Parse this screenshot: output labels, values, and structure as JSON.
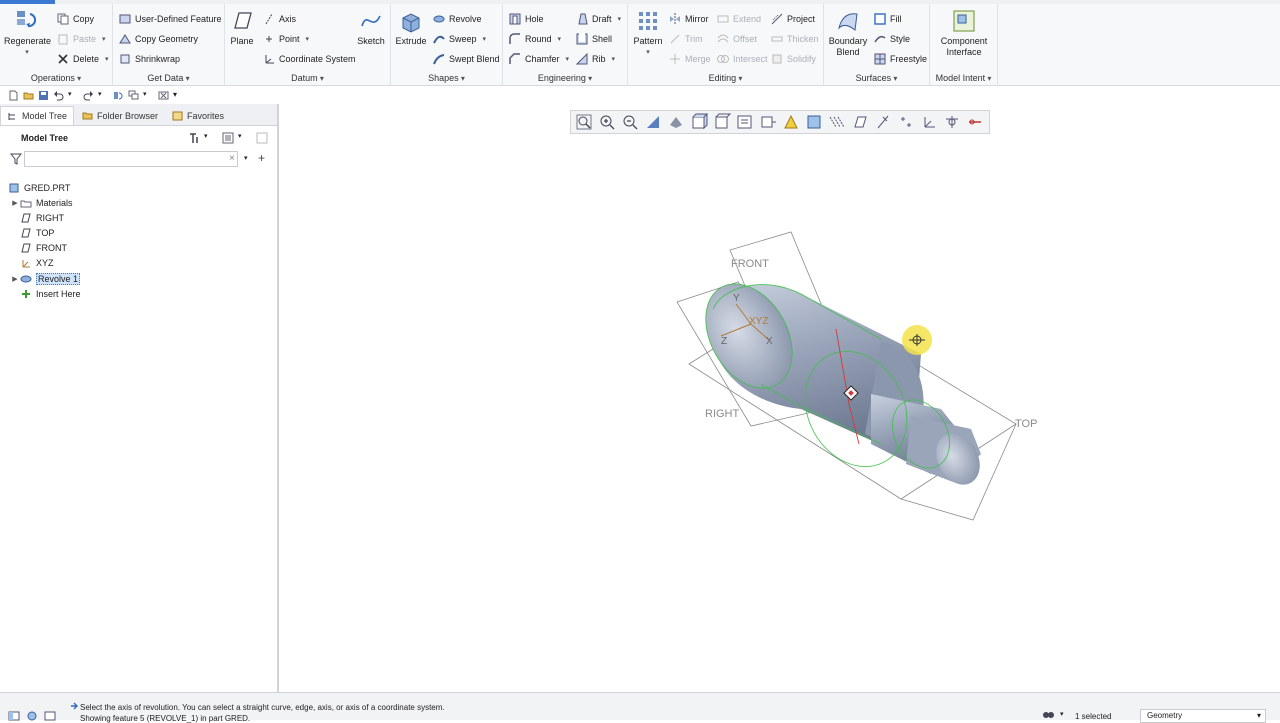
{
  "ribbon": {
    "groups": {
      "operations": "Operations",
      "get_data": "Get Data",
      "datum": "Datum",
      "shapes": "Shapes",
      "engineering": "Engineering",
      "editing": "Editing",
      "surfaces": "Surfaces",
      "model_intent": "Model Intent"
    },
    "regenerate": "Regenerate",
    "copy": "Copy",
    "paste": "Paste",
    "delete": "Delete",
    "user_defined_feature": "User-Defined Feature",
    "copy_geometry": "Copy Geometry",
    "shrinkwrap": "Shrinkwrap",
    "plane": "Plane",
    "axis": "Axis",
    "point": "Point",
    "coordinate_system": "Coordinate System",
    "sketch": "Sketch",
    "extrude": "Extrude",
    "revolve": "Revolve",
    "sweep": "Sweep",
    "swept_blend": "Swept Blend",
    "hole": "Hole",
    "round": "Round",
    "chamfer": "Chamfer",
    "draft": "Draft",
    "shell": "Shell",
    "rib": "Rib",
    "pattern": "Pattern",
    "mirror": "Mirror",
    "trim": "Trim",
    "merge": "Merge",
    "extend": "Extend",
    "offset": "Offset",
    "intersect": "Intersect",
    "project": "Project",
    "thicken": "Thicken",
    "solidify": "Solidify",
    "boundary_blend_1": "Boundary",
    "boundary_blend_2": "Blend",
    "fill": "Fill",
    "style": "Style",
    "freestyle": "Freestyle",
    "component_interface_1": "Component",
    "component_interface_2": "Interface"
  },
  "panel": {
    "tabs": [
      "Model Tree",
      "Folder Browser",
      "Favorites"
    ],
    "title": "Model Tree",
    "filter_value": "",
    "tree": [
      {
        "label": "GRED.PRT",
        "icon": "part-icon",
        "expander": ""
      },
      {
        "label": "Materials",
        "icon": "materials-icon",
        "expander": "▶"
      },
      {
        "label": "RIGHT",
        "icon": "datum-plane-icon",
        "expander": ""
      },
      {
        "label": "TOP",
        "icon": "datum-plane-icon",
        "expander": ""
      },
      {
        "label": "FRONT",
        "icon": "datum-plane-icon",
        "expander": ""
      },
      {
        "label": "XYZ",
        "icon": "csys-icon",
        "expander": ""
      },
      {
        "label": "Revolve 1",
        "icon": "revolve-icon",
        "expander": "▶"
      },
      {
        "label": "Insert Here",
        "icon": "insert-here-icon",
        "expander": ""
      }
    ]
  },
  "viewport": {
    "labels": {
      "front": "FRONT",
      "right": "RIGHT",
      "top": "TOP",
      "csys": "XYZ",
      "x": "X",
      "y": "Y",
      "z": "Z"
    }
  },
  "status": {
    "message": "Select the axis of revolution. You can select a straight curve, edge, axis, or axis of a coordinate system.",
    "message2": "Showing feature 5 (REVOLVE_1) in part GRED.",
    "selected": "1 selected",
    "filter": "Geometry"
  },
  "colors": {
    "accent": "#3a7ad5",
    "model": "#9aa7bd",
    "highlight_green": "#3fbf4a",
    "cursor_yellow": "#f3e34a"
  }
}
